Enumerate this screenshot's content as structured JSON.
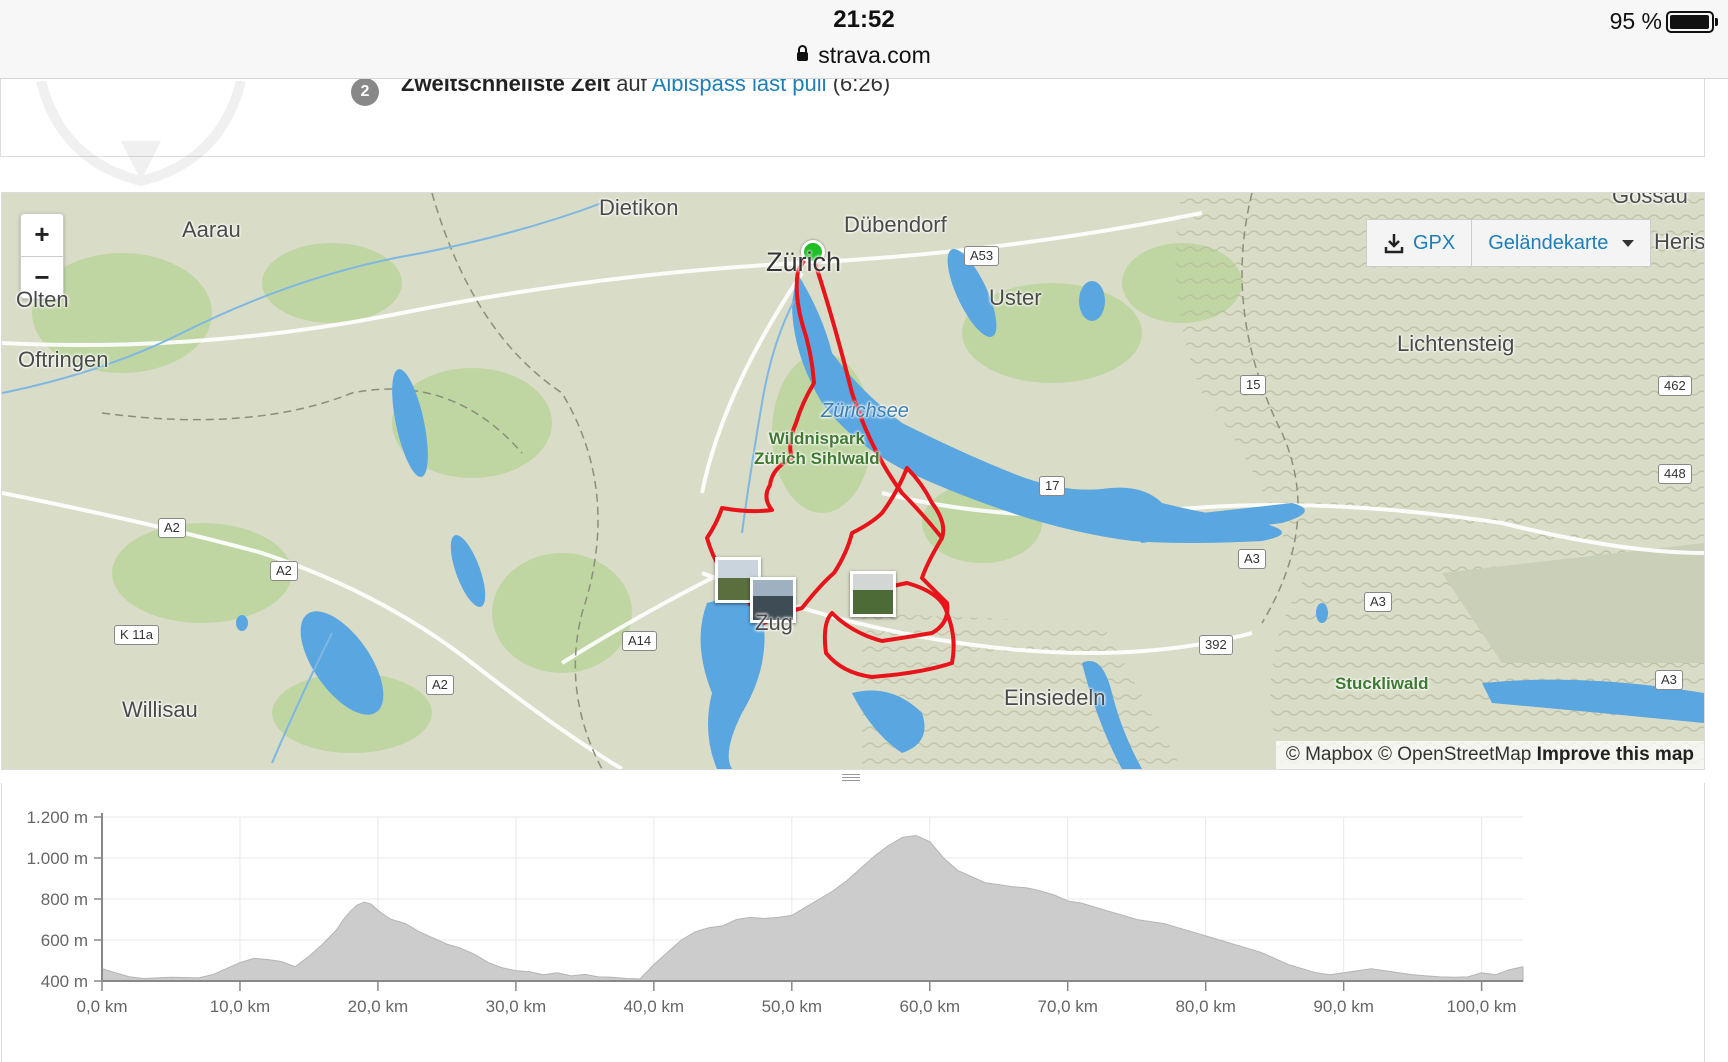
{
  "status_bar": {
    "time": "21:52",
    "url": "strava.com",
    "battery": "95 %"
  },
  "achievement": {
    "rank": "2",
    "title": "Zweitschnellste Zeit",
    "connector": "auf",
    "segment": "Albispass last pull",
    "time": "(6:26)"
  },
  "map": {
    "zoom_in": "+",
    "zoom_out": "−",
    "gpx_label": "GPX",
    "maptype_label": "Geländekarte",
    "attribution": {
      "mapbox": "© Mapbox",
      "osm": "© OpenStreetMap",
      "improve": "Improve this map"
    },
    "places": {
      "dietikon": "Dietikon",
      "aarau": "Aarau",
      "duebendorf": "Dübendorf",
      "zuerich": "Zürich",
      "gossau": "Gossau",
      "herisau": "Herisa",
      "olten": "Olten",
      "uster": "Uster",
      "oftringen": "Oftringen",
      "lichtensteig": "Lichtensteig",
      "zuerichsee": "Zürichsee",
      "wildnispark": "Wildnispark",
      "sihlwald": "Zürich Sihlwald",
      "zug": "Zug",
      "einsiedeln": "Einsiedeln",
      "willisau": "Willisau",
      "stuckliwald": "Stuckliwald"
    },
    "roads": {
      "a53": "A53",
      "r15": "15",
      "r462": "462",
      "r17": "17",
      "r448": "448",
      "a2_1": "A2",
      "a2_2": "A2",
      "a3_1": "A3",
      "a3_2": "A3",
      "k11a": "K 11a",
      "a14": "A14",
      "r392": "392",
      "a2_3": "A2",
      "a3_3": "A3"
    },
    "colors": {
      "route": "#e8141b",
      "lake": "#5aa6e0",
      "start": "#1fbf24"
    }
  },
  "chart_data": {
    "type": "area",
    "xlabel": "",
    "ylabel": "",
    "xlim": [
      0,
      103
    ],
    "ylim": [
      400,
      1200
    ],
    "x_ticks": [
      "0,0 km",
      "10,0 km",
      "20,0 km",
      "30,0 km",
      "40,0 km",
      "50,0 km",
      "60,0 km",
      "70,0 km",
      "80,0 km",
      "90,0 km",
      "100,0 km"
    ],
    "x_tick_values": [
      0,
      10,
      20,
      30,
      40,
      50,
      60,
      70,
      80,
      90,
      100
    ],
    "y_ticks": [
      "400 m",
      "600 m",
      "800 m",
      "1.000 m",
      "1.200 m"
    ],
    "y_tick_values": [
      400,
      600,
      800,
      1000,
      1200
    ],
    "grid": true,
    "color": "#cccccc",
    "x": [
      0,
      1,
      2,
      3,
      5,
      7,
      8,
      9,
      10,
      11,
      12,
      13,
      14,
      15,
      16,
      17,
      17.5,
      18,
      18.5,
      19,
      19.5,
      20,
      20.5,
      21,
      22,
      23,
      24,
      25,
      26,
      27,
      28,
      29,
      30,
      31,
      32,
      33,
      34,
      35,
      36,
      37,
      38,
      39,
      40,
      41,
      42,
      43,
      44,
      45,
      46,
      47,
      48,
      49,
      50,
      51,
      52,
      53,
      54,
      55,
      56,
      57,
      58,
      59,
      60,
      61,
      62,
      63,
      64,
      65,
      66,
      67,
      68,
      69,
      70,
      71,
      72,
      73,
      74,
      75,
      76,
      77,
      78,
      79,
      80,
      81,
      82,
      83,
      84,
      85,
      86,
      87,
      88,
      89,
      90,
      91,
      92,
      93,
      94,
      95,
      96,
      97,
      98,
      99,
      100,
      101,
      102,
      103
    ],
    "y": [
      460,
      440,
      420,
      412,
      418,
      415,
      430,
      460,
      490,
      510,
      505,
      495,
      470,
      520,
      580,
      650,
      700,
      740,
      770,
      785,
      775,
      745,
      720,
      700,
      680,
      640,
      610,
      580,
      560,
      530,
      490,
      465,
      450,
      445,
      430,
      440,
      425,
      432,
      420,
      418,
      412,
      410,
      480,
      540,
      600,
      640,
      660,
      670,
      700,
      710,
      705,
      710,
      720,
      760,
      800,
      840,
      890,
      950,
      1010,
      1060,
      1100,
      1110,
      1080,
      1000,
      940,
      910,
      880,
      870,
      860,
      855,
      840,
      820,
      790,
      780,
      760,
      740,
      720,
      700,
      690,
      680,
      660,
      640,
      620,
      600,
      580,
      560,
      540,
      510,
      480,
      460,
      440,
      430,
      440,
      450,
      460,
      450,
      440,
      430,
      425,
      420,
      418,
      420,
      440,
      430,
      455,
      470
    ]
  }
}
